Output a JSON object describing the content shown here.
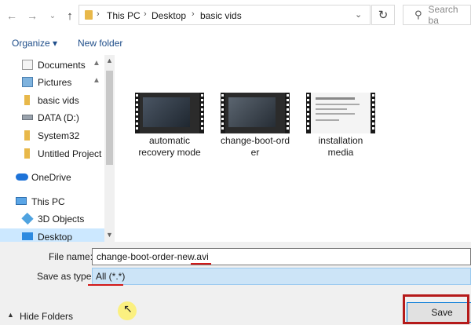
{
  "address": {
    "crumbs": [
      "This PC",
      "Desktop",
      "basic vids"
    ],
    "search_placeholder": "Search ba"
  },
  "toolbar": {
    "organize": "Organize ▾",
    "new_folder": "New folder"
  },
  "nav": {
    "items": [
      {
        "label": "Documents",
        "icon": "documents-icon",
        "pinned": true
      },
      {
        "label": "Pictures",
        "icon": "pictures-icon",
        "pinned": true
      },
      {
        "label": "basic vids",
        "icon": "folder-icon",
        "pinned": false
      },
      {
        "label": "DATA (D:)",
        "icon": "drive-icon",
        "pinned": false
      },
      {
        "label": "System32",
        "icon": "folder-icon",
        "pinned": false
      },
      {
        "label": "Untitled Project",
        "icon": "folder-icon",
        "pinned": false
      },
      {
        "label": "OneDrive",
        "icon": "onedrive-icon",
        "pinned": false
      },
      {
        "label": "This PC",
        "icon": "this-pc-icon",
        "pinned": false
      },
      {
        "label": "3D Objects",
        "icon": "3d-objects-icon",
        "pinned": false
      },
      {
        "label": "Desktop",
        "icon": "desktop-icon",
        "pinned": false
      }
    ]
  },
  "files": [
    {
      "line1": "automatic",
      "line2": "recovery mode"
    },
    {
      "line1": "change-boot-ord",
      "line2": "er"
    },
    {
      "line1": "installation",
      "line2": "media"
    }
  ],
  "form": {
    "file_name_label": "File name:",
    "file_name_value": "change-boot-order-new.avi",
    "save_type_label": "Save as type:",
    "save_type_value": "All (*.*)"
  },
  "footer": {
    "hide_folders": "Hide Folders",
    "save": "Save"
  },
  "colors": {
    "accent": "#0078d7",
    "selection": "#cce4f7",
    "annotation_red": "#b51a1a"
  }
}
